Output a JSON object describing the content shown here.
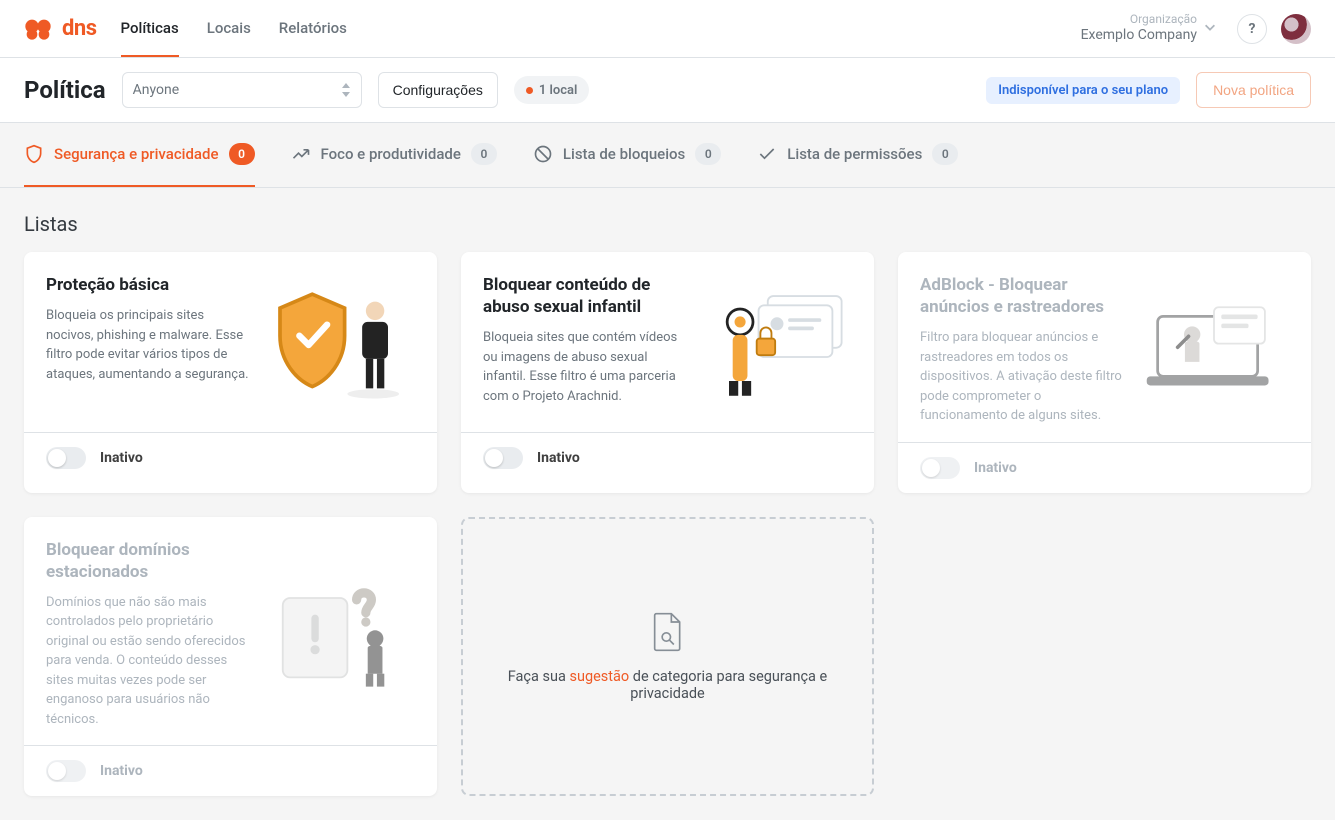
{
  "brand": "dns",
  "nav": {
    "items": [
      "Políticas",
      "Locais",
      "Relatórios"
    ],
    "active_index": 0
  },
  "org": {
    "label": "Organização",
    "name": "Exemplo Company"
  },
  "help_char": "?",
  "page": {
    "title": "Política",
    "policy_selector": "Anyone",
    "config_btn": "Configurações",
    "locations_badge": "1 local",
    "plan_notice": "Indisponível para o seu plano",
    "new_policy_btn": "Nova política"
  },
  "subtabs": [
    {
      "label": "Segurança e privacidade",
      "count": 0,
      "active": true,
      "icon": "shield"
    },
    {
      "label": "Foco e produtividade",
      "count": 0,
      "active": false,
      "icon": "trend"
    },
    {
      "label": "Lista de bloqueios",
      "count": 0,
      "active": false,
      "icon": "block"
    },
    {
      "label": "Lista de permissões",
      "count": 0,
      "active": false,
      "icon": "check"
    }
  ],
  "section_heading": "Listas",
  "cards": [
    {
      "title": "Proteção básica",
      "desc": "Bloqueia os principais sites nocivos, phishing e malware. Esse filtro pode evitar vários tipos de ataques, aumentando a segurança.",
      "status": "Inativo",
      "disabled": false
    },
    {
      "title": "Bloquear conteúdo de abuso sexual infantil",
      "desc": "Bloqueia sites que contém vídeos ou imagens de abuso sexual infantil. Esse filtro é uma parceria com o Projeto Arachnid.",
      "status": "Inativo",
      "disabled": false
    },
    {
      "title": "AdBlock - Bloquear anúncios e rastreadores",
      "desc": "Filtro para bloquear anúncios e rastreadores em todos os dispositivos. A ativação deste filtro pode comprometer o funcionamento de alguns sites.",
      "status": "Inativo",
      "disabled": true
    },
    {
      "title": "Bloquear domínios estacionados",
      "desc": "Domínios que não são mais controlados pelo proprietário original ou estão sendo oferecidos para venda. O conteúdo desses sites muitas vezes pode ser enganoso para usuários não técnicos.",
      "status": "Inativo",
      "disabled": true
    }
  ],
  "suggest": {
    "prefix": "Faça sua ",
    "link": "sugestão",
    "suffix": " de categoria para segurança e privacidade"
  }
}
